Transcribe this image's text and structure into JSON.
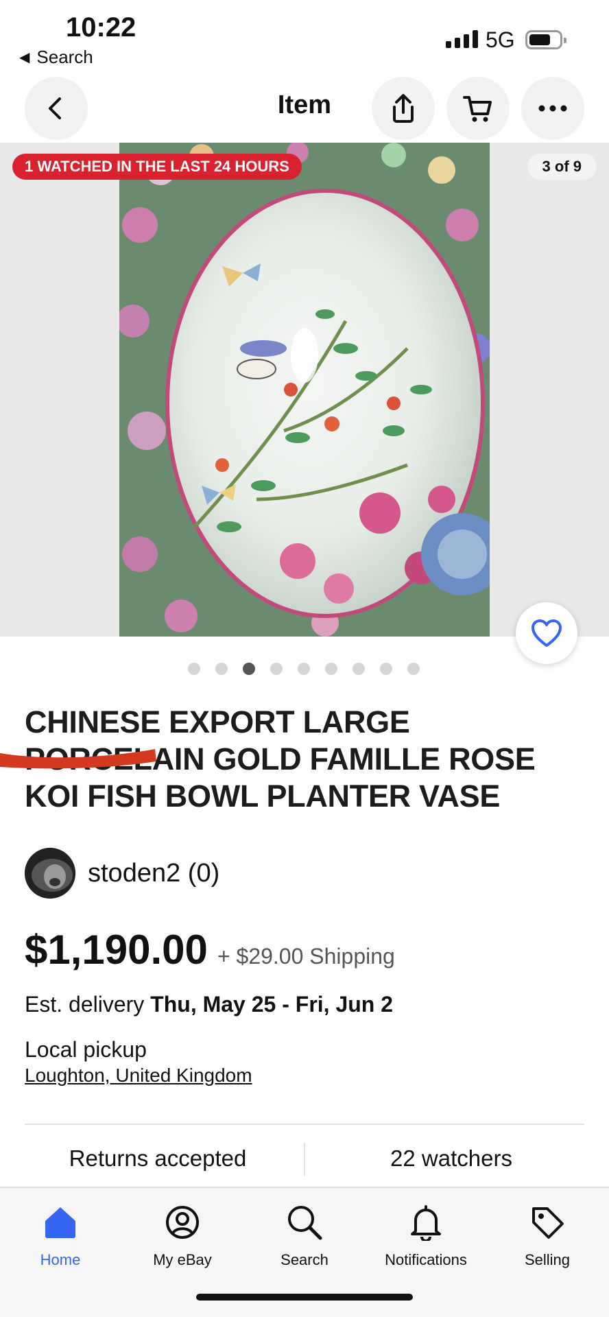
{
  "status_bar": {
    "time": "10:22",
    "back_app_label": "Search",
    "network": "5G"
  },
  "nav": {
    "title": "Item",
    "back_icon": "chevron-left-icon",
    "share_icon": "share-icon",
    "cart_icon": "cart-icon",
    "more_icon": "more-icon"
  },
  "gallery": {
    "watch_badge": "1 WATCHED IN THE LAST 24 HOURS",
    "counter": "3 of 9",
    "current_index": 3,
    "total": 9
  },
  "listing": {
    "title": "CHINESE EXPORT LARGE PORCELAIN GOLD FAMILLE ROSE KOI FISH BOWL PLANTER VASE",
    "seller": "stoden2 (0)",
    "price": "$1,190.00",
    "shipping": "+ $29.00 Shipping",
    "delivery_label": "Est. delivery",
    "delivery_dates": "Thu, May 25 - Fri, Jun 2",
    "pickup_label": "Local pickup",
    "pickup_location": "Loughton, United Kingdom",
    "returns": "Returns accepted",
    "watchers": "22 watchers"
  },
  "tabbar": {
    "items": [
      {
        "label": "Home",
        "icon": "home-icon",
        "active": true
      },
      {
        "label": "My eBay",
        "icon": "user-circle-icon",
        "active": false
      },
      {
        "label": "Search",
        "icon": "search-icon",
        "active": false
      },
      {
        "label": "Notifications",
        "icon": "bell-icon",
        "active": false
      },
      {
        "label": "Selling",
        "icon": "tag-icon",
        "active": false
      }
    ]
  },
  "colors": {
    "accent": "#3665f3",
    "badge_red": "#d8222f",
    "redaction": "#d3391f"
  }
}
